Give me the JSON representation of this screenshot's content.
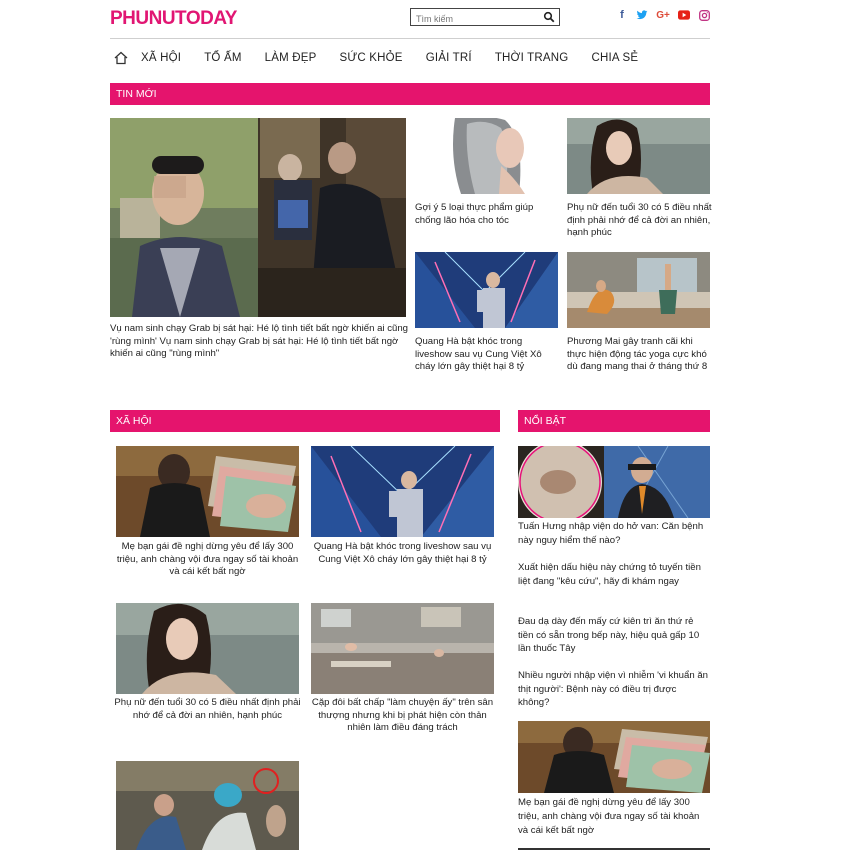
{
  "header": {
    "logo": "PHUNUTODAY",
    "search_placeholder": "Tìm kiếm",
    "social": [
      {
        "icon": "facebook-icon",
        "glyph": "f",
        "color": "#3b5998"
      },
      {
        "icon": "twitter-icon",
        "glyph": "t",
        "color": "#1da1f2"
      },
      {
        "icon": "google-plus-icon",
        "glyph": "G+",
        "color": "#dd4b39"
      },
      {
        "icon": "youtube-icon",
        "glyph": "▶",
        "color": "#e62117"
      },
      {
        "icon": "instagram-icon",
        "glyph": "◎",
        "color": "#c13584"
      }
    ]
  },
  "nav": {
    "items": [
      "XÃ HỘI",
      "TỔ ẤM",
      "LÀM ĐẸP",
      "SỨC KHỎE",
      "GIẢI TRÍ",
      "THỜI TRANG",
      "CHIA SẺ"
    ]
  },
  "colors": {
    "accent": "#e5146d",
    "logo": "#e11673"
  },
  "tin_moi": {
    "title": "TIN MỚI",
    "featured": {
      "caption": "Vụ nam sinh chạy Grab bị sát hại: Hé lộ tình tiết bất ngờ khiến ai cũng 'rùng mình' Vụ nam sinh chạy Grab bị sát hại: Hé lộ tình tiết bất ngờ khiến ai cũng \"rùng mình\""
    },
    "items": [
      {
        "caption": "Gợi ý 5 loại thực phẩm giúp chống lão hóa cho tóc"
      },
      {
        "caption": "Phụ nữ đến tuổi 30 có 5 điều nhất định phải nhớ để cả đời an nhiên, hạnh phúc"
      },
      {
        "caption": "Quang Hà bật khóc trong liveshow sau vụ Cung Việt Xô cháy lớn gây thiệt hại 8 tỷ"
      },
      {
        "caption": "Phương Mai gây tranh cãi khi thực hiện động tác yoga cực khó dù đang mang thai ở tháng thứ 8"
      }
    ]
  },
  "xa_hoi": {
    "title": "XÃ HỘI",
    "items": [
      {
        "caption": "Mẹ bạn gái đề nghị dừng yêu để lấy 300 triệu, anh chàng vội đưa ngay số tài khoản và cái kết bất ngờ"
      },
      {
        "caption": "Quang Hà bật khóc trong liveshow sau vụ Cung Việt Xô cháy lớn gây thiệt hại 8 tỷ"
      },
      {
        "caption": "Phụ nữ đến tuổi 30 có 5 điều nhất định phải nhớ để cả đời an nhiên, hạnh phúc"
      },
      {
        "caption": "Cặp đôi bất chấp \"làm chuyện ấy\" trên sân thượng nhưng khi bị phát hiện còn thản nhiên làm điều đáng trách"
      }
    ]
  },
  "noi_bat": {
    "title": "NỔI BẬT",
    "top_caption": "Tuấn Hưng nhập viện do hở van: Căn bệnh này nguy hiểm thế nào?",
    "links": [
      "Xuất hiện dấu hiệu này chứng tỏ tuyến tiền liệt đang \"kêu cứu\", hãy đi khám ngay",
      "Đau dạ dày đến mấy cứ kiên trì ăn thứ rẻ tiền có sẵn trong bếp này, hiệu quả gấp 10 lần thuốc Tây",
      "Nhiều người nhập viện vì nhiễm 'vi khuẩn ăn thịt người': Bệnh này có điều trị được không?"
    ],
    "bottom_caption": "Mẹ bạn gái đề nghị dừng yêu để lấy 300 triệu, anh chàng vội đưa ngay số tài khoản và cái kết bất ngờ"
  }
}
